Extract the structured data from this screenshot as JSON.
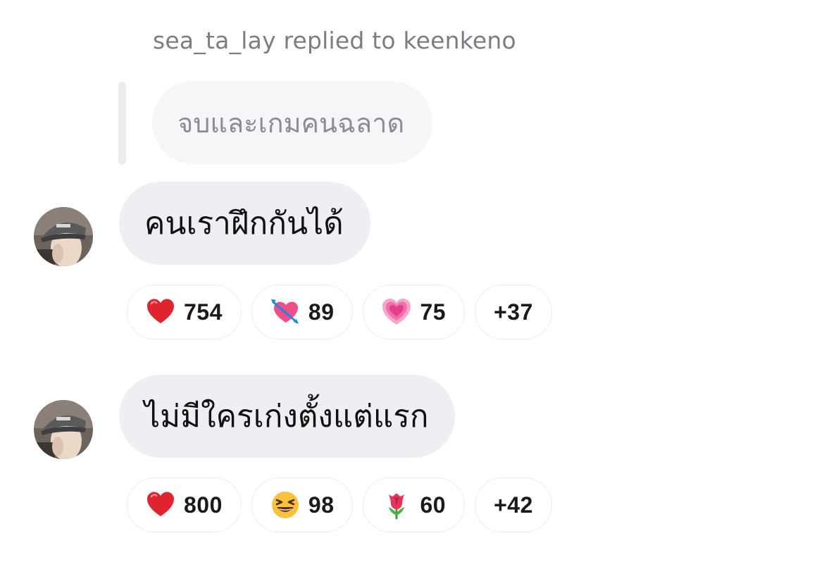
{
  "reply_context": {
    "header": "sea_ta_lay replied to keenkeno",
    "quoted_text": "จบและเกมคนฉลาด"
  },
  "messages": [
    {
      "avatar": "user-avatar",
      "text": "คนเราฝึกกันได้",
      "reactions": [
        {
          "icon": "red-heart-icon",
          "count": "754"
        },
        {
          "icon": "heart-with-arrow-icon",
          "count": "89"
        },
        {
          "icon": "growing-heart-icon",
          "count": "75"
        }
      ],
      "more": "+37"
    },
    {
      "avatar": "user-avatar",
      "text": "ไม่มีใครเก่งตั้งแต่แรก",
      "reactions": [
        {
          "icon": "red-heart-icon",
          "count": "800"
        },
        {
          "icon": "laughing-face-icon",
          "count": "98"
        },
        {
          "icon": "tulip-icon",
          "count": "60"
        }
      ],
      "more": "+42"
    }
  ],
  "colors": {
    "bubble": "#efeff3",
    "quote_bubble": "#f6f6f8",
    "meta_text": "#7a7d84",
    "pill_border": "#ececef"
  }
}
